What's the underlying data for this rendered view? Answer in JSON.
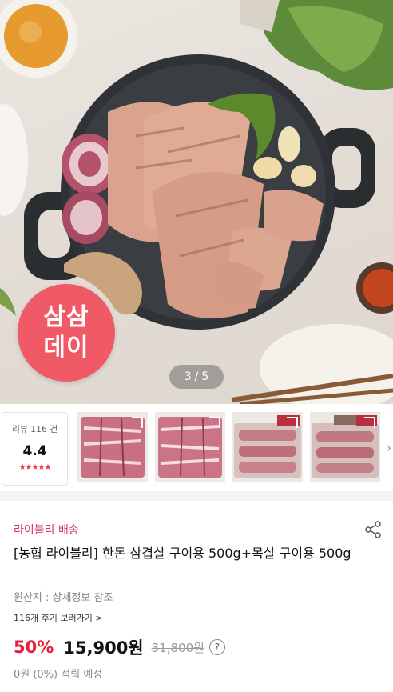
{
  "hero": {
    "badge_line1": "삼삼",
    "badge_line2": "데이",
    "counter_current": "3",
    "counter_sep": "/",
    "counter_total": "5",
    "badge_color": "#ef5a66"
  },
  "review": {
    "label": "리뷰",
    "count": "116",
    "unit": "건",
    "score": "4.4",
    "stars": "★★★★★"
  },
  "thumbnails": [
    {
      "name": "thumbnail-1"
    },
    {
      "name": "thumbnail-2"
    },
    {
      "name": "thumbnail-3"
    },
    {
      "name": "thumbnail-4"
    }
  ],
  "product": {
    "delivery": "라이블리 배송",
    "title": "[농협 라이블리] 한돈 삼겹살 구이용 500g+목살 구이용 500g",
    "origin": "원산지 : 상세정보 참조",
    "reviews_link": "116개 후기 보러가기 >",
    "discount": "50%",
    "price": "15,900원",
    "original_price": "31,800원",
    "help_icon": "?",
    "points": "0원 (0%) 적립 예정"
  },
  "colors": {
    "accent": "#d6336c",
    "discount": "#e6203a"
  }
}
